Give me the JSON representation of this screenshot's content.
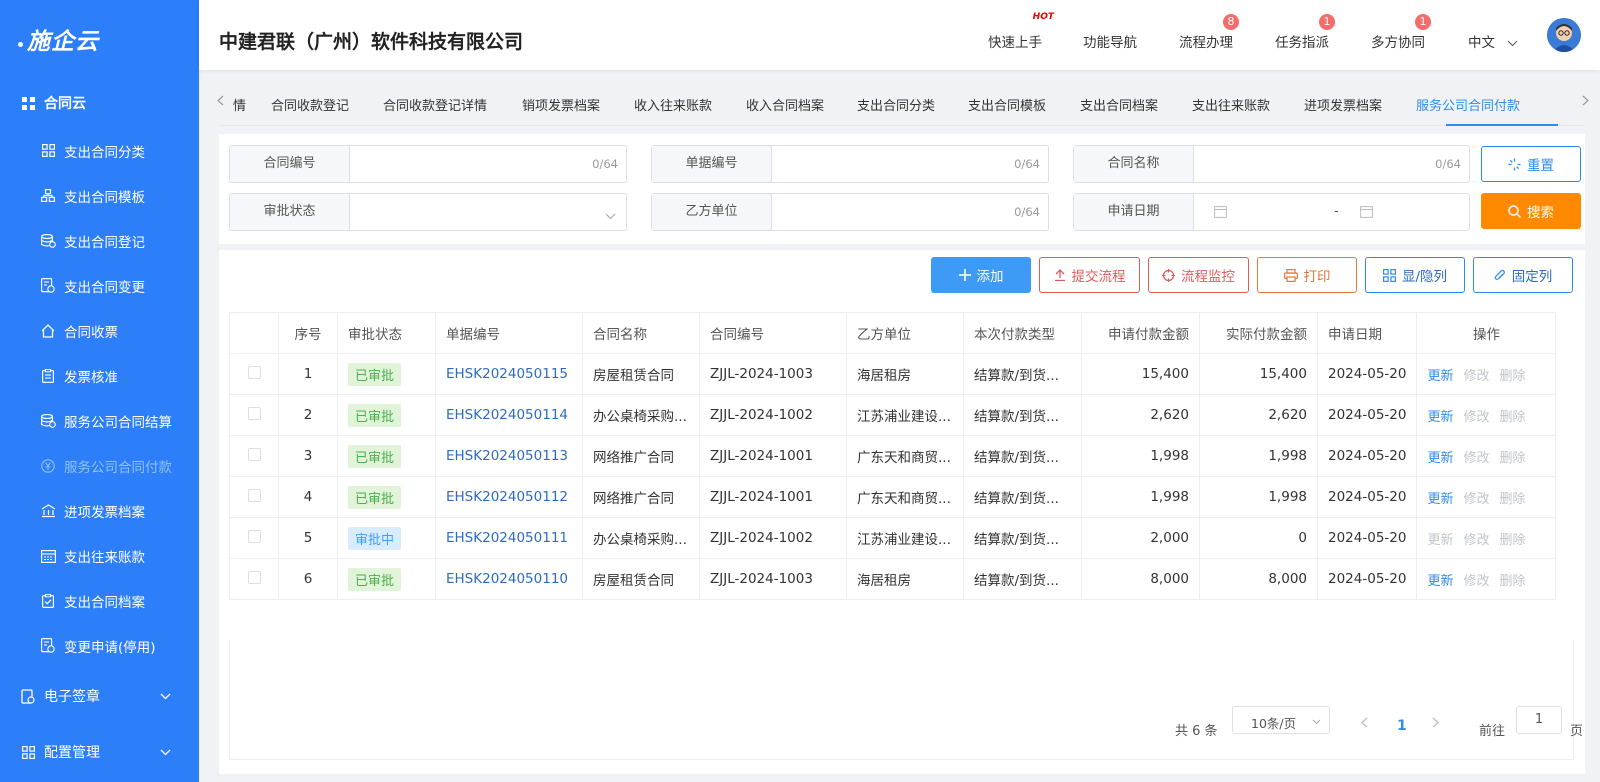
{
  "app": {
    "logo": "施企云"
  },
  "sidebar": {
    "group": "合同云",
    "items": [
      {
        "label": "支出合同分类",
        "icon": "grid-icon"
      },
      {
        "label": "支出合同模板",
        "icon": "sitemap-icon"
      },
      {
        "label": "支出合同登记",
        "icon": "db-edit-icon"
      },
      {
        "label": "支出合同变更",
        "icon": "doc-change-icon"
      },
      {
        "label": "合同收票",
        "icon": "home-icon"
      },
      {
        "label": "发票核准",
        "icon": "clipboard-icon"
      },
      {
        "label": "服务公司合同结算",
        "icon": "db-check-icon"
      },
      {
        "label": "服务公司合同付款",
        "icon": "yen-icon"
      },
      {
        "label": "进项发票档案",
        "icon": "bank-icon"
      },
      {
        "label": "支出往来账款",
        "icon": "ledger-icon"
      },
      {
        "label": "支出合同档案",
        "icon": "clipboard-check-icon"
      },
      {
        "label": "变更申请(停用)",
        "icon": "doc-change-icon"
      }
    ],
    "sub_e_sign": "电子签章",
    "sub_config": "配置管理"
  },
  "header": {
    "company": "中建君联（广州）软件科技有限公司",
    "quick_start": "快速上手",
    "hot": "HOT",
    "func_nav": "功能导航",
    "process": "流程办理",
    "process_badge": "8",
    "task": "任务指派",
    "task_badge": "1",
    "collab": "多方协同",
    "collab_badge": "1",
    "lang": "中文"
  },
  "tabs": {
    "partial": "情",
    "items": [
      "合同收款登记",
      "合同收款登记详情",
      "销项发票档案",
      "收入往来账款",
      "收入合同档案",
      "支出合同分类",
      "支出合同模板",
      "支出合同档案",
      "支出往来账款",
      "进项发票档案",
      "服务公司合同付款"
    ]
  },
  "search": {
    "contract_no": "合同编号",
    "bill_no": "单据编号",
    "contract_name": "合同名称",
    "approval_status": "审批状态",
    "party_b": "乙方单位",
    "apply_date": "申请日期",
    "counter": "0/64",
    "date_sep": "-",
    "reset": "重置",
    "search": "搜索"
  },
  "toolbar": {
    "add": "添加",
    "submit": "提交流程",
    "monitor": "流程监控",
    "print": "打印",
    "show_hide": "显/隐列",
    "fix_col": "固定列"
  },
  "table": {
    "headers": [
      "序号",
      "审批状态",
      "单据编号",
      "合同名称",
      "合同编号",
      "乙方单位",
      "本次付款类型",
      "申请付款金额",
      "实际付款金额",
      "申请日期",
      "操作"
    ],
    "rows": [
      {
        "no": "1",
        "status": "已审批",
        "bill": "EHSK2024050115",
        "name": "房屋租赁合同",
        "cno": "ZJJL-2024-1003",
        "party": "海居租房",
        "type": "结算款/到货...",
        "apply": "15,400",
        "actual": "15,400",
        "date": "2024-05-20"
      },
      {
        "no": "2",
        "status": "已审批",
        "bill": "EHSK2024050114",
        "name": "办公桌椅采购...",
        "cno": "ZJJL-2024-1002",
        "party": "江苏浦业建设...",
        "type": "结算款/到货...",
        "apply": "2,620",
        "actual": "2,620",
        "date": "2024-05-20"
      },
      {
        "no": "3",
        "status": "已审批",
        "bill": "EHSK2024050113",
        "name": "网络推广合同",
        "cno": "ZJJL-2024-1001",
        "party": "广东天和商贸...",
        "type": "结算款/到货...",
        "apply": "1,998",
        "actual": "1,998",
        "date": "2024-05-20"
      },
      {
        "no": "4",
        "status": "已审批",
        "bill": "EHSK2024050112",
        "name": "网络推广合同",
        "cno": "ZJJL-2024-1001",
        "party": "广东天和商贸...",
        "type": "结算款/到货...",
        "apply": "1,998",
        "actual": "1,998",
        "date": "2024-05-20"
      },
      {
        "no": "5",
        "status": "审批中",
        "bill": "EHSK2024050111",
        "name": "办公桌椅采购...",
        "cno": "ZJJL-2024-1002",
        "party": "江苏浦业建设...",
        "type": "结算款/到货...",
        "apply": "2,000",
        "actual": "0",
        "date": "2024-05-20"
      },
      {
        "no": "6",
        "status": "已审批",
        "bill": "EHSK2024050110",
        "name": "房屋租赁合同",
        "cno": "ZJJL-2024-1003",
        "party": "海居租房",
        "type": "结算款/到货...",
        "apply": "8,000",
        "actual": "8,000",
        "date": "2024-05-20"
      }
    ],
    "ops": [
      "更新",
      "修改",
      "删除"
    ]
  },
  "pagination": {
    "total": "共 6 条",
    "page_size": "10条/页",
    "current": "1",
    "goto": "前往",
    "goto_value": "1",
    "page_unit": "页"
  },
  "colors": {
    "sidebar": "#2d7ff9",
    "accent": "#2d8cf0",
    "orange": "#ff8a00",
    "danger": "#e05a5a"
  }
}
